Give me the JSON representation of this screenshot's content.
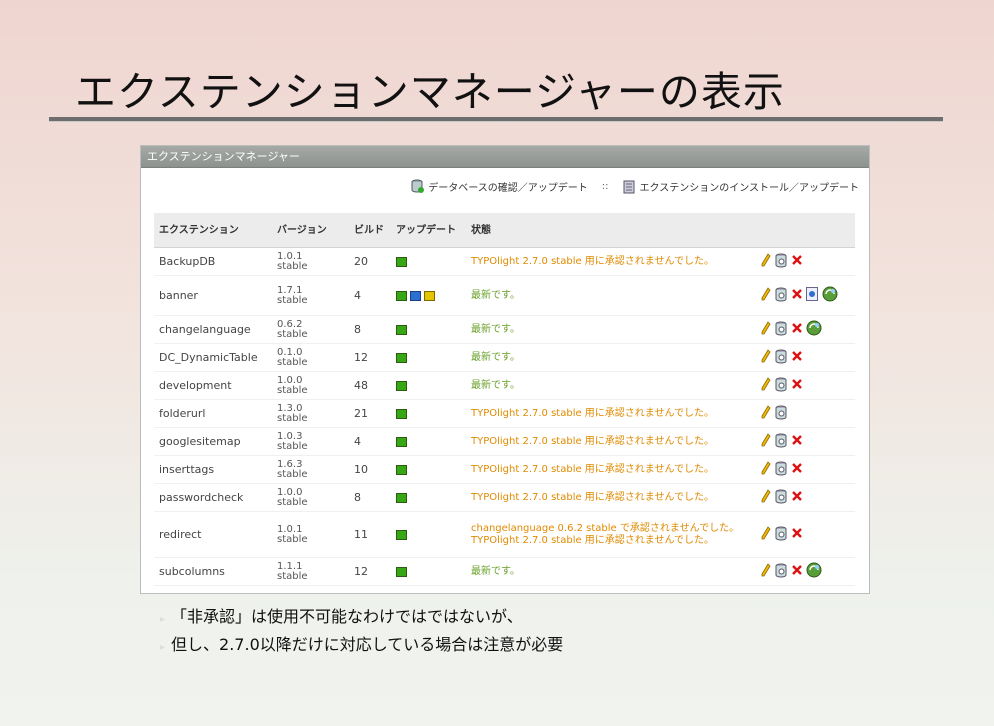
{
  "slide": {
    "title": "エクステンションマネージャーの表示",
    "bullets": [
      "「非承認」は使用不可能なわけではではないが、",
      "但し、2.7.0以降だけに対応している場合は注意が必要"
    ]
  },
  "panel": {
    "header": "エクステンションマネージャー",
    "link_db": "データベースの確認／アップデート",
    "separator": "::",
    "link_install": "エクステンションのインストール／アップデート"
  },
  "table": {
    "columns": [
      "エクステンション",
      "バージョン",
      "ビルド",
      "アップデート",
      "状態"
    ],
    "rows": [
      {
        "name": "BackupDB",
        "ver1": "1.0.1",
        "ver2": "stable",
        "build": "20",
        "status": "TYPOlight 2.7.0 stable 用に承認されませんでした。",
        "status2": "",
        "kind": "orange",
        "squares": [
          "g"
        ],
        "actions": [
          "edit",
          "db",
          "delete"
        ]
      },
      {
        "name": "banner",
        "ver1": "1.7.1",
        "ver2": "stable",
        "build": "4",
        "status": "最新です。",
        "status2": "",
        "kind": "green",
        "squares": [
          "g",
          "b",
          "y"
        ],
        "actions": [
          "edit",
          "db",
          "delete",
          "info",
          "update"
        ]
      },
      {
        "name": "changelanguage",
        "ver1": "0.6.2",
        "ver2": "stable",
        "build": "8",
        "status": "最新です。",
        "status2": "",
        "kind": "green",
        "squares": [
          "g"
        ],
        "actions": [
          "edit",
          "db",
          "delete",
          "update"
        ]
      },
      {
        "name": "DC_DynamicTable",
        "ver1": "0.1.0",
        "ver2": "stable",
        "build": "12",
        "status": "最新です。",
        "status2": "",
        "kind": "green",
        "squares": [
          "g"
        ],
        "actions": [
          "edit",
          "db",
          "delete"
        ]
      },
      {
        "name": "development",
        "ver1": "1.0.0",
        "ver2": "stable",
        "build": "48",
        "status": "最新です。",
        "status2": "",
        "kind": "green",
        "squares": [
          "g"
        ],
        "actions": [
          "edit",
          "db",
          "delete"
        ]
      },
      {
        "name": "folderurl",
        "ver1": "1.3.0",
        "ver2": "stable",
        "build": "21",
        "status": "TYPOlight 2.7.0 stable 用に承認されませんでした。",
        "status2": "",
        "kind": "orange",
        "squares": [
          "g"
        ],
        "actions": [
          "edit",
          "db"
        ]
      },
      {
        "name": "googlesitemap",
        "ver1": "1.0.3",
        "ver2": "stable",
        "build": "4",
        "status": "TYPOlight 2.7.0 stable 用に承認されませんでした。",
        "status2": "",
        "kind": "orange",
        "squares": [
          "g"
        ],
        "actions": [
          "edit",
          "db",
          "delete"
        ]
      },
      {
        "name": "inserttags",
        "ver1": "1.6.3",
        "ver2": "stable",
        "build": "10",
        "status": "TYPOlight 2.7.0 stable 用に承認されませんでした。",
        "status2": "",
        "kind": "orange",
        "squares": [
          "g"
        ],
        "actions": [
          "edit",
          "db",
          "delete"
        ]
      },
      {
        "name": "passwordcheck",
        "ver1": "1.0.0",
        "ver2": "stable",
        "build": "8",
        "status": "TYPOlight 2.7.0 stable 用に承認されませんでした。",
        "status2": "",
        "kind": "orange",
        "squares": [
          "g"
        ],
        "actions": [
          "edit",
          "db",
          "delete"
        ]
      },
      {
        "name": "redirect",
        "ver1": "1.0.1",
        "ver2": "stable",
        "build": "11",
        "status": "changelanguage 0.6.2 stable で承認されませんでした。",
        "status2": "TYPOlight 2.7.0 stable 用に承認されませんでした。",
        "kind": "orange",
        "squares": [
          "g"
        ],
        "actions": [
          "edit",
          "db",
          "delete"
        ]
      },
      {
        "name": "subcolumns",
        "ver1": "1.1.1",
        "ver2": "stable",
        "build": "12",
        "status": "最新です。",
        "status2": "",
        "kind": "green",
        "squares": [
          "g"
        ],
        "actions": [
          "edit",
          "db",
          "delete",
          "update"
        ]
      }
    ]
  }
}
